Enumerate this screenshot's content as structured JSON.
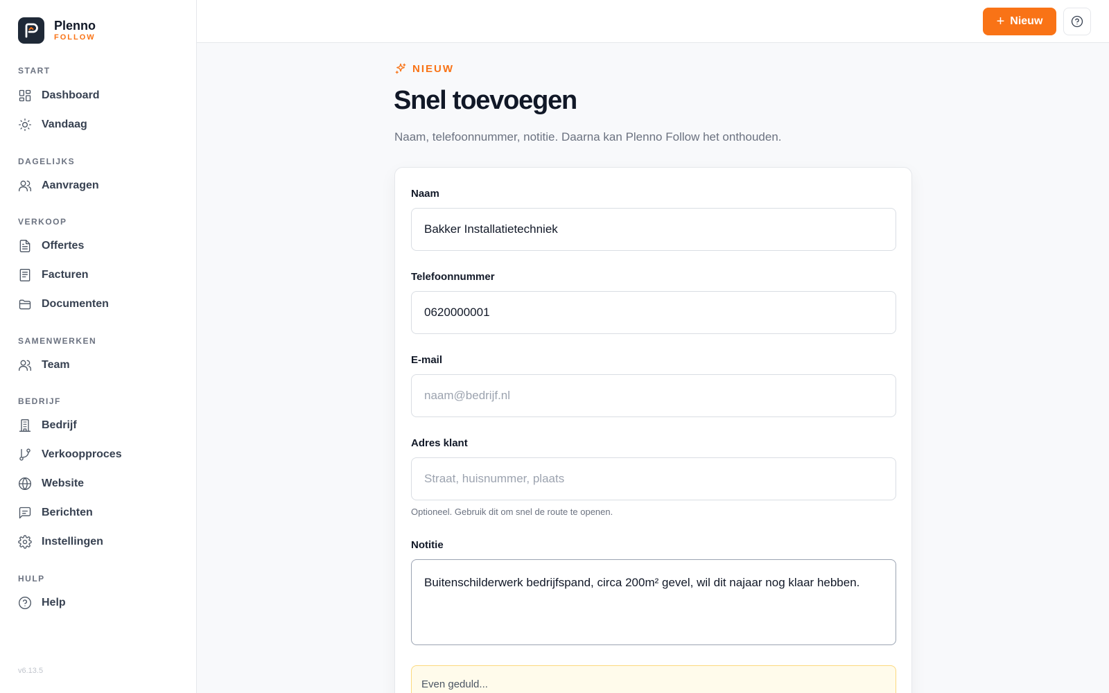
{
  "brand": {
    "name": "Plenno",
    "sub": "FOLLOW"
  },
  "sidebar": {
    "sections": [
      {
        "title": "START",
        "items": [
          {
            "label": "Dashboard",
            "icon": "dashboard-icon"
          },
          {
            "label": "Vandaag",
            "icon": "sun-icon"
          }
        ]
      },
      {
        "title": "DAGELIJKS",
        "items": [
          {
            "label": "Aanvragen",
            "icon": "users-icon"
          }
        ]
      },
      {
        "title": "VERKOOP",
        "items": [
          {
            "label": "Offertes",
            "icon": "file-text-icon"
          },
          {
            "label": "Facturen",
            "icon": "receipt-icon"
          },
          {
            "label": "Documenten",
            "icon": "folder-icon"
          }
        ]
      },
      {
        "title": "SAMENWERKEN",
        "items": [
          {
            "label": "Team",
            "icon": "users-icon"
          }
        ]
      },
      {
        "title": "BEDRIJF",
        "items": [
          {
            "label": "Bedrijf",
            "icon": "building-icon"
          },
          {
            "label": "Verkoopproces",
            "icon": "git-branch-icon"
          },
          {
            "label": "Website",
            "icon": "globe-icon"
          },
          {
            "label": "Berichten",
            "icon": "message-icon"
          },
          {
            "label": "Instellingen",
            "icon": "gear-icon"
          }
        ]
      },
      {
        "title": "HULP",
        "items": [
          {
            "label": "Help",
            "icon": "help-circle-icon"
          }
        ]
      }
    ],
    "version": "v6.13.5"
  },
  "topbar": {
    "new_label": "Nieuw",
    "help_icon": "help-circle-icon"
  },
  "header": {
    "eyebrow": "NIEUW",
    "title": "Snel toevoegen",
    "subtitle": "Naam, telefoonnummer, notitie. Daarna kan Plenno Follow het onthouden."
  },
  "form": {
    "name": {
      "label": "Naam",
      "value": "Bakker Installatietechniek"
    },
    "phone": {
      "label": "Telefoonnummer",
      "value": "0620000001"
    },
    "email": {
      "label": "E-mail",
      "value": "",
      "placeholder": "naam@bedrijf.nl"
    },
    "address": {
      "label": "Adres klant",
      "value": "",
      "placeholder": "Straat, huisnummer, plaats",
      "hint": "Optioneel. Gebruik dit om snel de route te openen."
    },
    "note": {
      "label": "Notitie",
      "value": "Buitenschilderwerk bedrijfspand, circa 200m² gevel, wil dit najaar nog klaar hebben."
    }
  },
  "status": {
    "text": "Even geduld..."
  },
  "colors": {
    "accent": "#f97316",
    "sidebar_bg": "#ffffff",
    "page_bg": "#f8f9fb"
  }
}
